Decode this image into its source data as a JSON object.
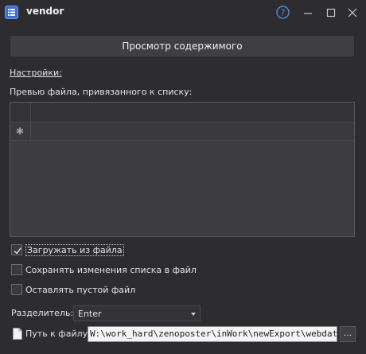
{
  "window": {
    "title": "vendor",
    "icon": "list-icon",
    "controls": [
      "help-icon",
      "minimize-icon",
      "maximize-icon",
      "close-icon"
    ]
  },
  "preview_button": {
    "label": "Просмотр содержимого"
  },
  "settings": {
    "heading": "Настройки:",
    "preview_label": "Превью файла, привязанного к списку:",
    "grid": {
      "new_row_marker": "✱"
    }
  },
  "options": [
    {
      "label": "Загружать из файла",
      "checked": true
    },
    {
      "label": "Сохранять изменения списка в файл",
      "checked": false
    },
    {
      "label": "Оставлять пустой файл",
      "checked": false
    }
  ],
  "separator": {
    "label": "Разделитель:",
    "value": "Enter"
  },
  "file_path": {
    "label": "Путь к файлу",
    "value": "W:\\work_hard\\zenoposter\\inWork\\newExport\\webdata\\vendor.txt",
    "browse_label": "..."
  }
}
